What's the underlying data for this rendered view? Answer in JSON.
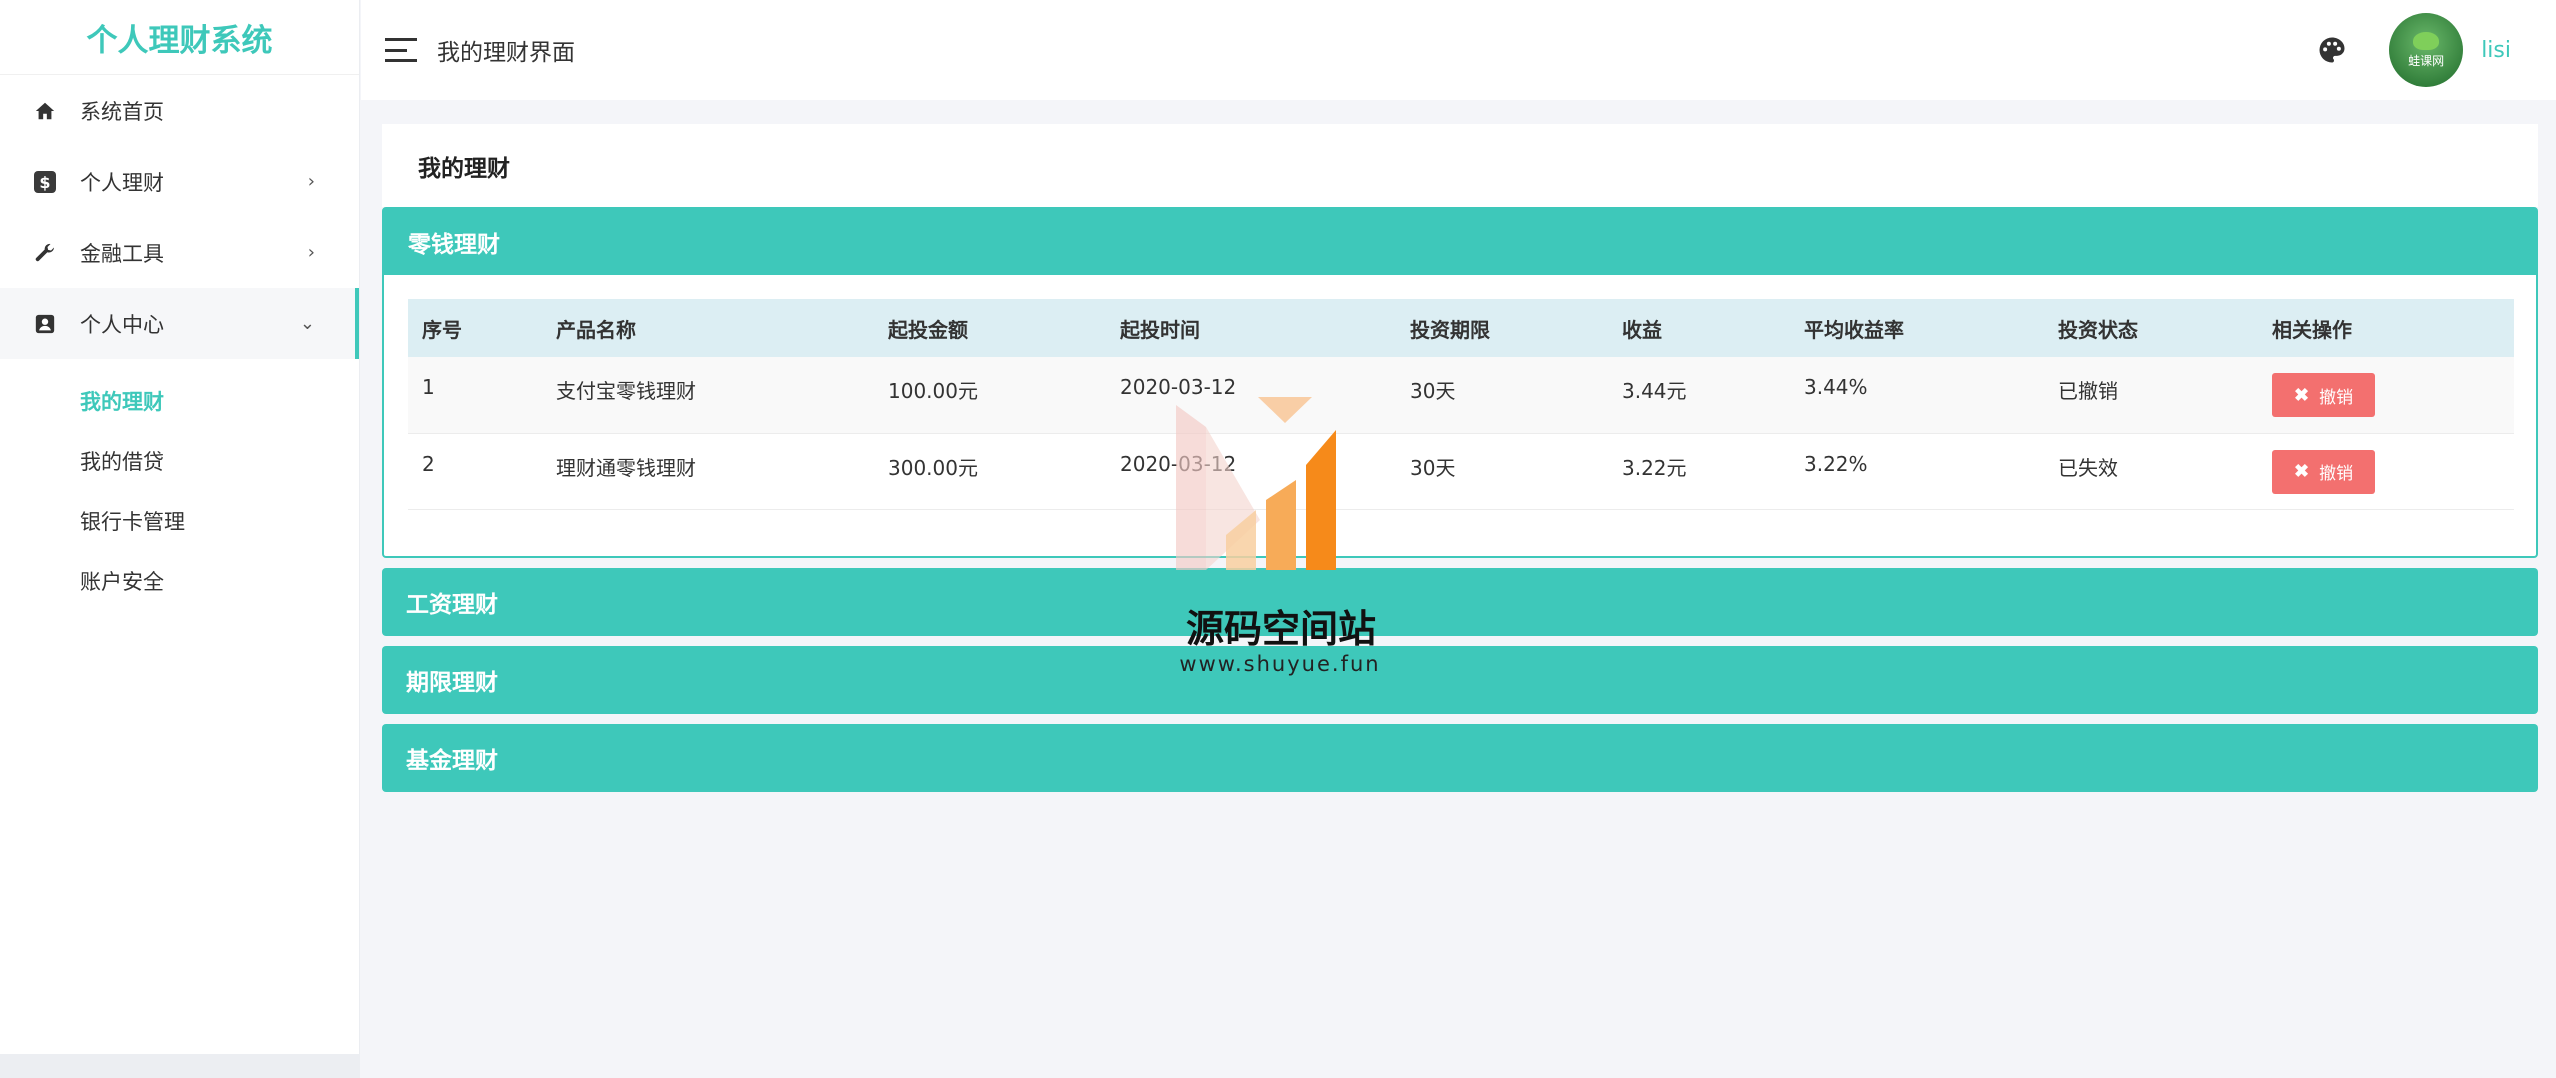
{
  "sidebar": {
    "brand": "个人理财系统",
    "menu": [
      {
        "label": "系统首页",
        "icon": "home-icon"
      },
      {
        "label": "个人理财",
        "icon": "dollar-icon",
        "chevron": "›"
      },
      {
        "label": "金融工具",
        "icon": "wrench-icon",
        "chevron": "›"
      },
      {
        "label": "个人中心",
        "icon": "user-card-icon",
        "chevron": "⌄"
      }
    ],
    "submenu": [
      {
        "label": "我的理财",
        "active": true
      },
      {
        "label": "我的借贷"
      },
      {
        "label": "银行卡管理"
      },
      {
        "label": "账户安全"
      }
    ]
  },
  "header": {
    "title": "我的理财界面",
    "username": "lisi",
    "avatar_text": "蛙课网"
  },
  "main": {
    "section_title": "我的理财",
    "panels": {
      "open": "零钱理财",
      "collapsed": [
        "工资理财",
        "期限理财",
        "基金理财"
      ]
    },
    "table": {
      "columns": [
        "序号",
        "产品名称",
        "起投金额",
        "起投时间",
        "投资期限",
        "收益",
        "平均收益率",
        "投资状态",
        "相关操作"
      ],
      "rows": [
        {
          "no": "1",
          "name": "支付宝零钱理财",
          "amount": "100.00元",
          "date": "2020-03-12",
          "term": "30天",
          "profit": "3.44元",
          "rate": "3.44%",
          "status": "已撤销",
          "action": "撤销"
        },
        {
          "no": "2",
          "name": "理财通零钱理财",
          "amount": "300.00元",
          "date": "2020-03-12",
          "term": "30天",
          "profit": "3.22元",
          "rate": "3.22%",
          "status": "已失效",
          "action": "撤销"
        }
      ]
    }
  },
  "watermark": {
    "title": "源码空间站",
    "url": "www.shuyue.fun"
  },
  "colors": {
    "accent": "#3ec8ba",
    "danger": "#f3706f",
    "table_head": "#dceef3"
  }
}
